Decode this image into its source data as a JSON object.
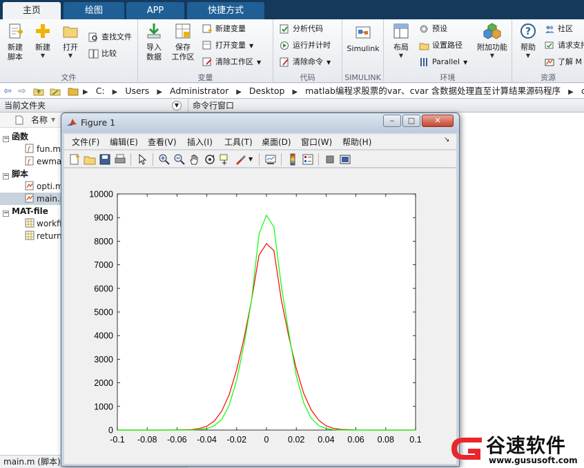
{
  "tabs": [
    {
      "label": "主页",
      "active": true
    },
    {
      "label": "绘图",
      "active": false
    },
    {
      "label": "APP",
      "active": false
    },
    {
      "label": "快捷方式",
      "active": false
    }
  ],
  "ribbon": {
    "file": {
      "label": "文件",
      "new_script": "新建\n脚本",
      "new": "新建",
      "open": "打开",
      "find_files": "查找文件",
      "compare": "比较"
    },
    "variable": {
      "label": "变量",
      "import_data": "导入\n数据",
      "save_workspace": "保存\n工作区",
      "new_variable": "新建变量",
      "open_variable": "打开变量",
      "clear_workspace": "清除工作区"
    },
    "code": {
      "label": "代码",
      "analyze_code": "分析代码",
      "run_and_time": "运行并计时",
      "clear_commands": "清除命令"
    },
    "simulink": {
      "label": "SIMULINK",
      "simulink": "Simulink"
    },
    "environment": {
      "label": "环境",
      "layout": "布局",
      "preferences": "预设",
      "set_path": "设置路径",
      "parallel": "Parallel",
      "addons": "附加功能"
    },
    "resources": {
      "label": "资源",
      "help": "帮助",
      "community": "社区",
      "request_support": "请求支持",
      "learn_matlab": "了解 M"
    }
  },
  "address": {
    "crumbs": [
      "C:",
      "Users",
      "Administrator",
      "Desktop",
      "matlab编程求股票的var、cvar 含数据处理直至计算结果源码程序",
      "code"
    ]
  },
  "panels": {
    "current_folder": "当前文件夹",
    "command_window": "命令行窗口",
    "name_column": "名称",
    "groups": [
      {
        "label": "函数",
        "items": [
          "fun.m",
          "ewma.m"
        ]
      },
      {
        "label": "脚本",
        "items": [
          "opti.m",
          "main.m"
        ]
      },
      {
        "label": "MAT-file",
        "items": [
          "workfile",
          "return"
        ]
      }
    ],
    "status": "main.m  (脚本)"
  },
  "figure": {
    "title": "Figure 1",
    "min": "‒",
    "max": "□",
    "close": "✕",
    "menu": [
      "文件(F)",
      "编辑(E)",
      "查看(V)",
      "插入(I)",
      "工具(T)",
      "桌面(D)",
      "窗口(W)",
      "帮助(H)"
    ],
    "menu_arrow": "↘"
  },
  "logo": {
    "text": "谷速软件",
    "url": "www.gususoft.com",
    "color": "#e8262c"
  },
  "chart_data": {
    "type": "line",
    "xlim": [
      -0.1,
      0.1
    ],
    "ylim": [
      0,
      10000
    ],
    "xticks": [
      -0.1,
      -0.08,
      -0.06,
      -0.04,
      -0.02,
      0,
      0.02,
      0.04,
      0.06,
      0.08,
      0.1
    ],
    "yticks": [
      0,
      1000,
      2000,
      3000,
      4000,
      5000,
      6000,
      7000,
      8000,
      9000,
      10000
    ],
    "xtick_labels": [
      "-0.1",
      "-0.08",
      "-0.06",
      "-0.04",
      "-0.02",
      "0",
      "0.02",
      "0.04",
      "0.06",
      "0.08",
      "0.1"
    ],
    "ytick_labels": [
      "0",
      "1000",
      "2000",
      "3000",
      "4000",
      "5000",
      "6000",
      "7000",
      "8000",
      "9000",
      "10000"
    ],
    "grid": false,
    "series": [
      {
        "color": "#ff0000",
        "x": [
          -0.1,
          -0.09,
          -0.08,
          -0.07,
          -0.06,
          -0.05,
          -0.045,
          -0.04,
          -0.035,
          -0.03,
          -0.025,
          -0.02,
          -0.015,
          -0.01,
          -0.005,
          0,
          0.005,
          0.01,
          0.015,
          0.02,
          0.025,
          0.03,
          0.035,
          0.04,
          0.045,
          0.05,
          0.06,
          0.07,
          0.08,
          0.09,
          0.1
        ],
        "y": [
          0,
          0,
          0,
          0,
          2,
          20,
          60,
          160,
          380,
          800,
          1500,
          2550,
          3900,
          5500,
          7400,
          7900,
          7600,
          5500,
          3950,
          2600,
          1550,
          850,
          420,
          180,
          70,
          25,
          4,
          0,
          0,
          0,
          0
        ]
      },
      {
        "color": "#00ff00",
        "x": [
          -0.1,
          -0.09,
          -0.08,
          -0.07,
          -0.06,
          -0.05,
          -0.045,
          -0.04,
          -0.035,
          -0.03,
          -0.025,
          -0.02,
          -0.015,
          -0.01,
          -0.005,
          0,
          0.005,
          0.01,
          0.015,
          0.02,
          0.025,
          0.03,
          0.035,
          0.04,
          0.045,
          0.05,
          0.06,
          0.07,
          0.08,
          0.09,
          0.1
        ],
        "y": [
          0,
          0,
          0,
          0,
          0,
          5,
          20,
          60,
          180,
          450,
          1050,
          2100,
          3650,
          5500,
          8300,
          9100,
          8600,
          6100,
          4100,
          2300,
          1150,
          500,
          190,
          60,
          15,
          4,
          0,
          0,
          0,
          0,
          0
        ]
      }
    ]
  }
}
